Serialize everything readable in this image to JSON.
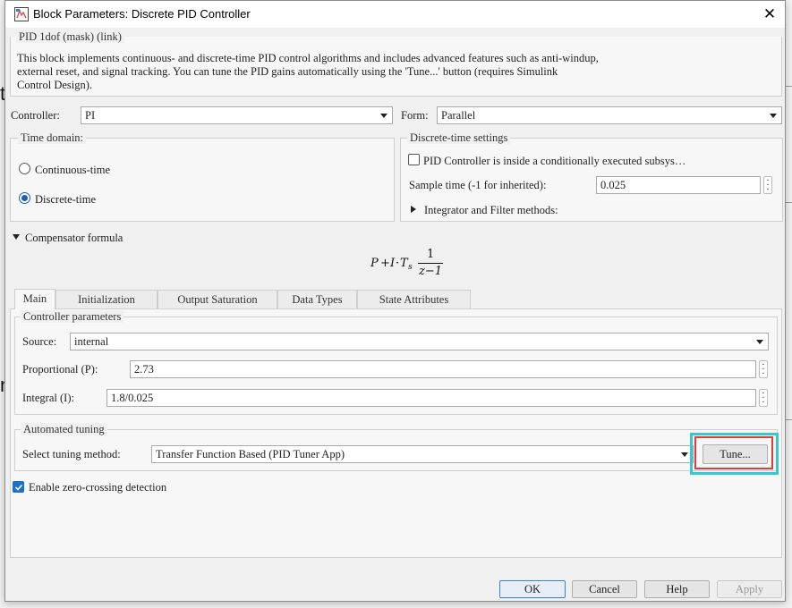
{
  "window": {
    "title": "Block Parameters: Discrete PID Controller",
    "close_symbol": "✕"
  },
  "background": {
    "chars": [
      "t",
      "n"
    ]
  },
  "description": {
    "group_title": "PID 1dof (mask) (link)",
    "lines": [
      "This block implements continuous- and discrete-time PID control algorithms and includes advanced features such as anti-windup,",
      "external reset, and signal tracking. You can tune the PID gains automatically using the 'Tune...' button (requires Simulink",
      "Control Design)."
    ]
  },
  "controller": {
    "label": "Controller:",
    "value": "PI"
  },
  "form": {
    "label": "Form:",
    "value": "Parallel"
  },
  "time_domain": {
    "title": "Time domain:",
    "options": [
      {
        "label": "Continuous-time",
        "selected": false
      },
      {
        "label": "Discrete-time",
        "selected": true
      }
    ]
  },
  "discrete_settings": {
    "title": "Discrete-time settings",
    "conditional_checkbox": {
      "label": "PID Controller is inside a conditionally executed subsys…",
      "checked": false
    },
    "sample_time": {
      "label": "Sample time (-1 for inherited):",
      "value": "0.025"
    },
    "integrator_methods": {
      "label": "Integrator and Filter methods:"
    }
  },
  "compensator": {
    "label": "Compensator formula",
    "formula": {
      "p": "P",
      "plus": "+",
      "i": "I",
      "dot": "·",
      "t": "T",
      "sub": "s",
      "num": "1",
      "den": "z−1"
    }
  },
  "tabs": [
    {
      "label": "Main",
      "active": true
    },
    {
      "label": "Initialization",
      "active": false
    },
    {
      "label": "Output Saturation",
      "active": false
    },
    {
      "label": "Data Types",
      "active": false
    },
    {
      "label": "State Attributes",
      "active": false
    }
  ],
  "controller_parameters": {
    "title": "Controller parameters",
    "source": {
      "label": "Source:",
      "value": "internal"
    },
    "proportional": {
      "label": "Proportional (P):",
      "value": "2.73"
    },
    "integral": {
      "label": "Integral (I):",
      "value": "1.8/0.025"
    }
  },
  "automated_tuning": {
    "title": "Automated tuning",
    "method_label": "Select tuning method:",
    "method_value": "Transfer Function Based (PID Tuner App)",
    "tune_button": "Tune..."
  },
  "zero_crossing": {
    "label": "Enable zero-crossing detection",
    "checked": true
  },
  "buttons": {
    "ok": "OK",
    "cancel": "Cancel",
    "help": "Help",
    "apply": "Apply"
  },
  "colors": {
    "highlight_outer": "#36c8cf",
    "highlight_inner": "#e03b3b",
    "accent": "#1a73c9"
  }
}
